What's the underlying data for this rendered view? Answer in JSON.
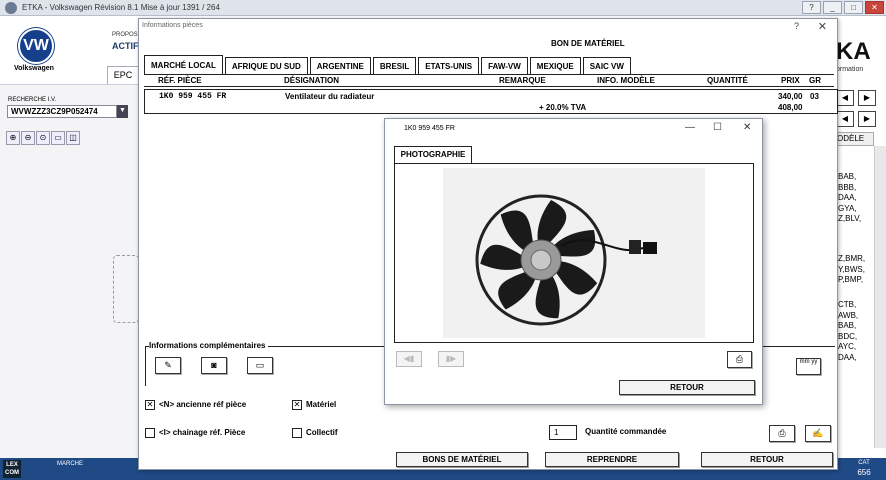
{
  "window": {
    "title": "ETKA - Volkswagen Révision 8.1 Mise à jour 1391 / 264",
    "btn_help": "?",
    "btn_min": "_",
    "btn_max": "□",
    "btn_close": "✕"
  },
  "brand": {
    "name": "Volkswagen",
    "logo_text": "VW"
  },
  "header": {
    "proposition": "PROPOS",
    "actif": "ACTIF",
    "epc_tab": "EPC",
    "etka": "KA",
    "etka_sub": "ormation"
  },
  "search": {
    "label": "RECHERCHE I.V.",
    "vin": "WVWZZZ3CZ9P052474"
  },
  "right_panel": {
    "modele_label": "ODÈLE",
    "codes_a": [
      "BAB,",
      "BBB,",
      "DAA,",
      "GYA,",
      "Z,BLV,"
    ],
    "codes_b": [
      "Z,BMR,",
      "Y,BWS,",
      "P,BMP,"
    ],
    "codes_c": [
      "CTB,",
      "AWB,",
      "BAB,",
      "BDC,",
      "AYC,",
      "DAA,"
    ]
  },
  "status_bar": {
    "lexcom": "LEX COM",
    "marche": "MARCHE",
    "cat_label": "CAT",
    "cat_value": "656"
  },
  "info_dialog": {
    "title": "Informations pièces",
    "help": "?",
    "close": "✕",
    "section_title": "BON DE MATÉRIEL",
    "tabs": [
      "MARCHÉ LOCAL",
      "AFRIQUE DU SUD",
      "ARGENTINE",
      "BRESIL",
      "ETATS-UNIS",
      "FAW-VW",
      "MEXIQUE",
      "SAIC VW"
    ],
    "columns": {
      "ref": "RÉF. PIÈCE",
      "designation": "DÉSIGNATION",
      "remarque": "REMARQUE",
      "info_modele": "INFO. MODÈLE",
      "quantite": "QUANTITÉ",
      "prix": "PRIX",
      "gr": "GR"
    },
    "row": {
      "ref": "1K0 959 455 FR",
      "designation": "Ventilateur du radiateur",
      "prix": "340,00",
      "gr": "03",
      "tva_label": "+ 20.0% TVA",
      "prix_ttc": "408,00"
    },
    "info_comp_label": "Informations complémentaires",
    "unit_label": "mm yy",
    "checks": {
      "ancienne_label": "<N> ancienne réf pièce",
      "ancienne_checked": "✕",
      "materiel_label": "Matériel",
      "materiel_checked": "✕",
      "chainage_label": "<I> chainage réf. Pièce",
      "collectif_label": "Collectif"
    },
    "quantity": {
      "value": "1",
      "label": "Quantité commandée"
    },
    "buttons": {
      "bons": "BONS DE MATÉRIEL",
      "reprendre": "REPRENDRE",
      "retour": "RETOUR"
    }
  },
  "photo_dialog": {
    "title": "1K0 959 455 FR",
    "tab": "PHOTOGRAPHIE",
    "retour": "RETOUR",
    "min": "—",
    "max": "☐",
    "close": "✕"
  }
}
